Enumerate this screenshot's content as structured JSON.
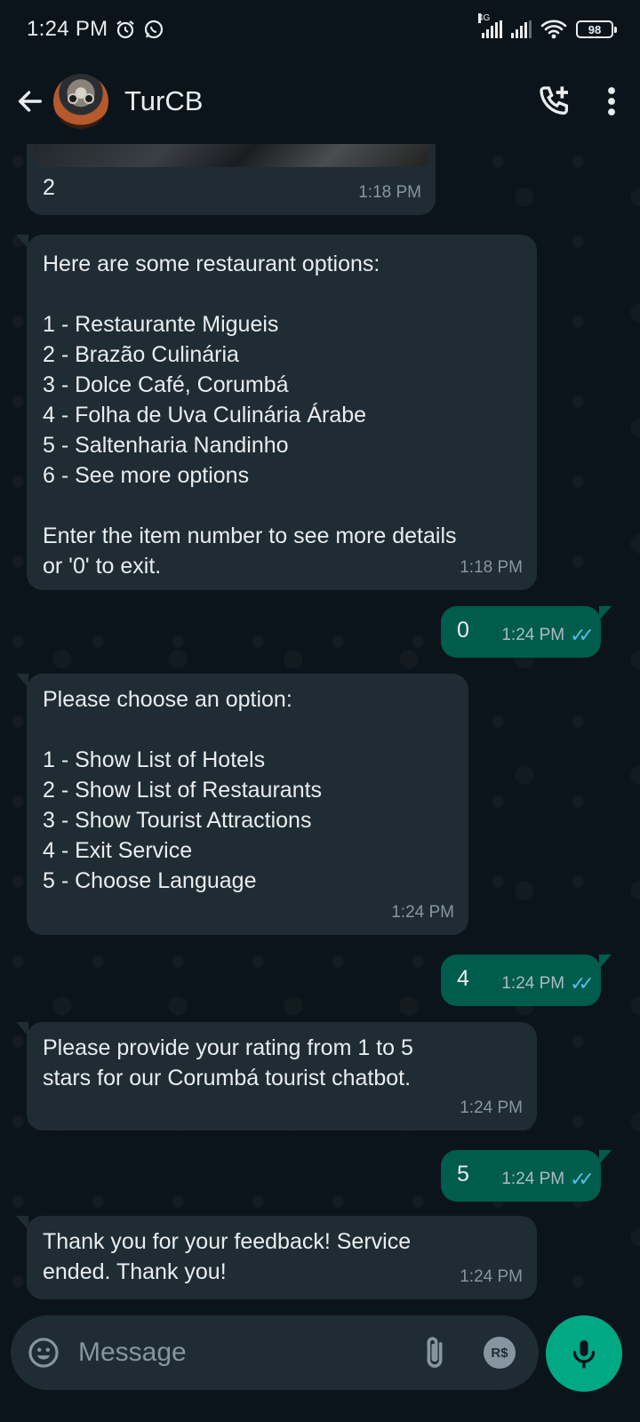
{
  "status_bar": {
    "time": "1:24 PM",
    "network_label": "4G",
    "battery": "98"
  },
  "header": {
    "contact_name": "TurCB",
    "icons": [
      "back-arrow-icon",
      "avatar",
      "add-call-icon",
      "more-vert-icon"
    ]
  },
  "messages": [
    {
      "id": "m0",
      "direction": "in",
      "text": "2",
      "time": "1:18 PM",
      "has_image": true
    },
    {
      "id": "m1",
      "direction": "in",
      "text": "Here are some restaurant options:\n\n1 - Restaurante Migueis\n2 - Brazão Culinária\n3 - Dolce Café, Corumbá\n4 - Folha de Uva Culinária Árabe\n5 - Saltenharia Nandinho\n6 - See more options\n\nEnter the item number to see more details\nor '0' to exit.",
      "time": "1:18 PM"
    },
    {
      "id": "m2",
      "direction": "out",
      "text": "0",
      "time": "1:24 PM",
      "read": true
    },
    {
      "id": "m3",
      "direction": "in",
      "text": "Please choose an option:\n\n1 - Show List of Hotels\n2 - Show List of Restaurants\n3 - Show Tourist Attractions\n4 - Exit Service\n5 - Choose Language",
      "time": "1:24 PM"
    },
    {
      "id": "m4",
      "direction": "out",
      "text": "4",
      "time": "1:24 PM",
      "read": true
    },
    {
      "id": "m5",
      "direction": "in",
      "text": "Please provide your rating from 1 to 5\nstars for our Corumbá tourist chatbot.",
      "time": "1:24 PM"
    },
    {
      "id": "m6",
      "direction": "out",
      "text": "5",
      "time": "1:24 PM",
      "read": true
    },
    {
      "id": "m7",
      "direction": "in",
      "text": "Thank you for your feedback! Service\nended. Thank you!",
      "time": "1:24 PM"
    }
  ],
  "composer": {
    "placeholder": "Message",
    "currency_badge": "R$",
    "icons": [
      "emoji-icon",
      "attach-icon",
      "payment-icon",
      "camera-icon",
      "mic-icon"
    ]
  },
  "colors": {
    "background": "#0b141a",
    "incoming_bubble": "#202c33",
    "outgoing_bubble": "#005c4b",
    "accent": "#00a884",
    "read_ticks": "#53bdeb"
  }
}
